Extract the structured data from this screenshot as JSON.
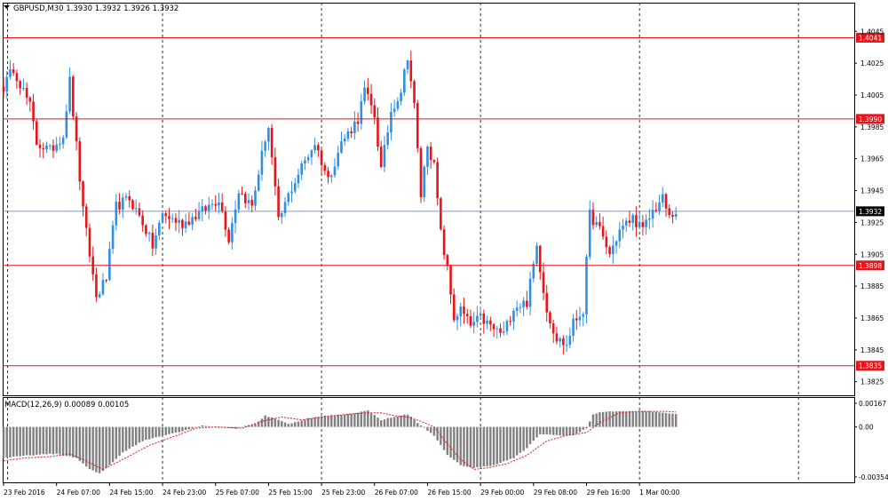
{
  "header": {
    "symbol_text": "GBPUSD,M30  1.3930 1.3932 1.3926 1.3932"
  },
  "macd_panel": {
    "label": "MACD(12,26,9) 0.00089 0.00105"
  },
  "colors": {
    "bull": "#2e8fe5",
    "bear": "#e8141a",
    "level_line": "#e8141a",
    "price_line": "#4a7fc0",
    "macd_hist": "#808080",
    "signal": "#e8141a",
    "grid": "#000000"
  },
  "chart_data": [
    {
      "type": "candlestick",
      "title": "GBPUSD,M30",
      "ohlc_readout": [
        1.393,
        1.3932,
        1.3926,
        1.3932
      ],
      "ylim": [
        1.3815,
        1.4048
      ],
      "y_ticks": [
        "1.4045",
        "1.4025",
        "1.4005",
        "1.3985",
        "1.3965",
        "1.3945",
        "1.3925",
        "1.3905",
        "1.3885",
        "1.3865",
        "1.3845",
        "1.3825"
      ],
      "y_tick_values": [
        1.4045,
        1.4025,
        1.4005,
        1.3985,
        1.3965,
        1.3945,
        1.3925,
        1.3905,
        1.3885,
        1.3865,
        1.3845,
        1.3825
      ],
      "x_labels": [
        "23 Feb 2016",
        "24 Feb 07:00",
        "24 Feb 15:00",
        "24 Feb 23:00",
        "25 Feb 07:00",
        "25 Feb 15:00",
        "25 Feb 23:00",
        "26 Feb 07:00",
        "26 Feb 15:00",
        "29 Feb 00:00",
        "29 Feb 08:00",
        "29 Feb 16:00",
        "1 Mar 00:00"
      ],
      "x_label_bars": [
        0,
        16,
        32,
        48,
        64,
        80,
        96,
        112,
        128,
        144,
        160,
        176,
        192
      ],
      "session_separator_bars": [
        48,
        96,
        144,
        192,
        240
      ],
      "horizontal_levels": [
        {
          "value": 1.4041,
          "label": "1.4041"
        },
        {
          "value": 1.399,
          "label": "1.3990"
        },
        {
          "value": 1.3898,
          "label": "1.3898"
        },
        {
          "value": 1.3835,
          "label": "1.3835"
        }
      ],
      "current_price": {
        "value": 1.3932,
        "label": "1.3932"
      },
      "anchors": [
        [
          0,
          1.401
        ],
        [
          3,
          1.4022
        ],
        [
          8,
          1.3998
        ],
        [
          10,
          1.3975
        ],
        [
          14,
          1.397
        ],
        [
          18,
          1.398
        ],
        [
          20,
          1.4014
        ],
        [
          24,
          1.3932
        ],
        [
          28,
          1.3878
        ],
        [
          31,
          1.389
        ],
        [
          34,
          1.3935
        ],
        [
          38,
          1.394
        ],
        [
          42,
          1.3925
        ],
        [
          45,
          1.391
        ],
        [
          48,
          1.393
        ],
        [
          54,
          1.3924
        ],
        [
          60,
          1.3932
        ],
        [
          65,
          1.394
        ],
        [
          68,
          1.3915
        ],
        [
          71,
          1.3945
        ],
        [
          75,
          1.3935
        ],
        [
          79,
          1.3978
        ],
        [
          80,
          1.3985
        ],
        [
          83,
          1.3925
        ],
        [
          86,
          1.3942
        ],
        [
          90,
          1.396
        ],
        [
          94,
          1.3975
        ],
        [
          98,
          1.3952
        ],
        [
          102,
          1.3975
        ],
        [
          107,
          1.399
        ],
        [
          109,
          1.4008
        ],
        [
          112,
          1.3992
        ],
        [
          114,
          1.3958
        ],
        [
          117,
          1.3995
        ],
        [
          120,
          1.4008
        ],
        [
          122,
          1.403
        ],
        [
          124,
          1.3998
        ],
        [
          126,
          1.3942
        ],
        [
          128,
          1.3975
        ],
        [
          130,
          1.396
        ],
        [
          132,
          1.3918
        ],
        [
          134,
          1.3895
        ],
        [
          136,
          1.3865
        ],
        [
          138,
          1.387
        ],
        [
          141,
          1.386
        ],
        [
          144,
          1.3865
        ],
        [
          148,
          1.3858
        ],
        [
          151,
          1.3855
        ],
        [
          154,
          1.3872
        ],
        [
          158,
          1.3875
        ],
        [
          161,
          1.391
        ],
        [
          164,
          1.387
        ],
        [
          167,
          1.3852
        ],
        [
          170,
          1.3848
        ],
        [
          172,
          1.3862
        ],
        [
          175,
          1.387
        ],
        [
          177,
          1.393
        ],
        [
          180,
          1.392
        ],
        [
          183,
          1.3905
        ],
        [
          186,
          1.392
        ],
        [
          190,
          1.3928
        ],
        [
          193,
          1.392
        ],
        [
          196,
          1.3932
        ],
        [
          199,
          1.394
        ],
        [
          201,
          1.3928
        ],
        [
          203,
          1.3932
        ]
      ]
    },
    {
      "type": "macd",
      "name": "MACD(12,26,9)",
      "values_readout": [
        0.00089,
        0.00105
      ],
      "ylim": [
        -0.00354,
        0.00167
      ],
      "y_ticks": [
        "0.00167",
        "0.00",
        "-0.00354"
      ],
      "hist_anchors": [
        [
          0,
          -0.0022
        ],
        [
          8,
          -0.002
        ],
        [
          16,
          -0.0019
        ],
        [
          22,
          -0.0022
        ],
        [
          26,
          -0.003
        ],
        [
          29,
          -0.0033
        ],
        [
          32,
          -0.0027
        ],
        [
          36,
          -0.0018
        ],
        [
          42,
          -0.001
        ],
        [
          48,
          -0.0006
        ],
        [
          54,
          -0.0003
        ],
        [
          60,
          0.0001
        ],
        [
          64,
          0.0
        ],
        [
          70,
          -0.0001
        ],
        [
          76,
          0.0002
        ],
        [
          79,
          0.0008
        ],
        [
          82,
          0.0006
        ],
        [
          86,
          0.0002
        ],
        [
          92,
          0.0006
        ],
        [
          98,
          0.0008
        ],
        [
          104,
          0.0009
        ],
        [
          110,
          0.00115
        ],
        [
          114,
          0.0005
        ],
        [
          118,
          0.0007
        ],
        [
          122,
          0.0009
        ],
        [
          126,
          0.0001
        ],
        [
          130,
          -0.0006
        ],
        [
          134,
          -0.002
        ],
        [
          138,
          -0.0027
        ],
        [
          142,
          -0.0029
        ],
        [
          148,
          -0.0027
        ],
        [
          154,
          -0.0022
        ],
        [
          158,
          -0.0015
        ],
        [
          162,
          -0.0005
        ],
        [
          168,
          -0.0006
        ],
        [
          172,
          -0.0006
        ],
        [
          176,
          -0.0001
        ],
        [
          178,
          0.0009
        ],
        [
          182,
          0.0011
        ],
        [
          188,
          0.0011
        ],
        [
          194,
          0.0011
        ],
        [
          200,
          0.001
        ],
        [
          203,
          0.00089
        ]
      ],
      "signal_anchors": [
        [
          0,
          -0.0024
        ],
        [
          6,
          -0.0022
        ],
        [
          14,
          -0.0021
        ],
        [
          20,
          -0.0019
        ],
        [
          24,
          -0.0023
        ],
        [
          30,
          -0.003
        ],
        [
          36,
          -0.0023
        ],
        [
          44,
          -0.0013
        ],
        [
          50,
          -0.0008
        ],
        [
          58,
          -0.0001
        ],
        [
          64,
          0.0
        ],
        [
          72,
          -0.0001
        ],
        [
          78,
          0.0004
        ],
        [
          84,
          0.0007
        ],
        [
          90,
          0.0005
        ],
        [
          96,
          0.0007
        ],
        [
          104,
          0.0009
        ],
        [
          110,
          0.001
        ],
        [
          114,
          0.001
        ],
        [
          118,
          0.0008
        ],
        [
          122,
          0.0007
        ],
        [
          126,
          0.0004
        ],
        [
          130,
          0.0
        ],
        [
          134,
          -0.0012
        ],
        [
          138,
          -0.0023
        ],
        [
          142,
          -0.003
        ],
        [
          146,
          -0.0029
        ],
        [
          152,
          -0.0026
        ],
        [
          158,
          -0.002
        ],
        [
          164,
          -0.001
        ],
        [
          170,
          -0.0006
        ],
        [
          176,
          -0.0004
        ],
        [
          180,
          0.0003
        ],
        [
          186,
          0.001
        ],
        [
          192,
          0.0011
        ],
        [
          200,
          0.0011
        ],
        [
          203,
          0.00105
        ]
      ]
    }
  ]
}
